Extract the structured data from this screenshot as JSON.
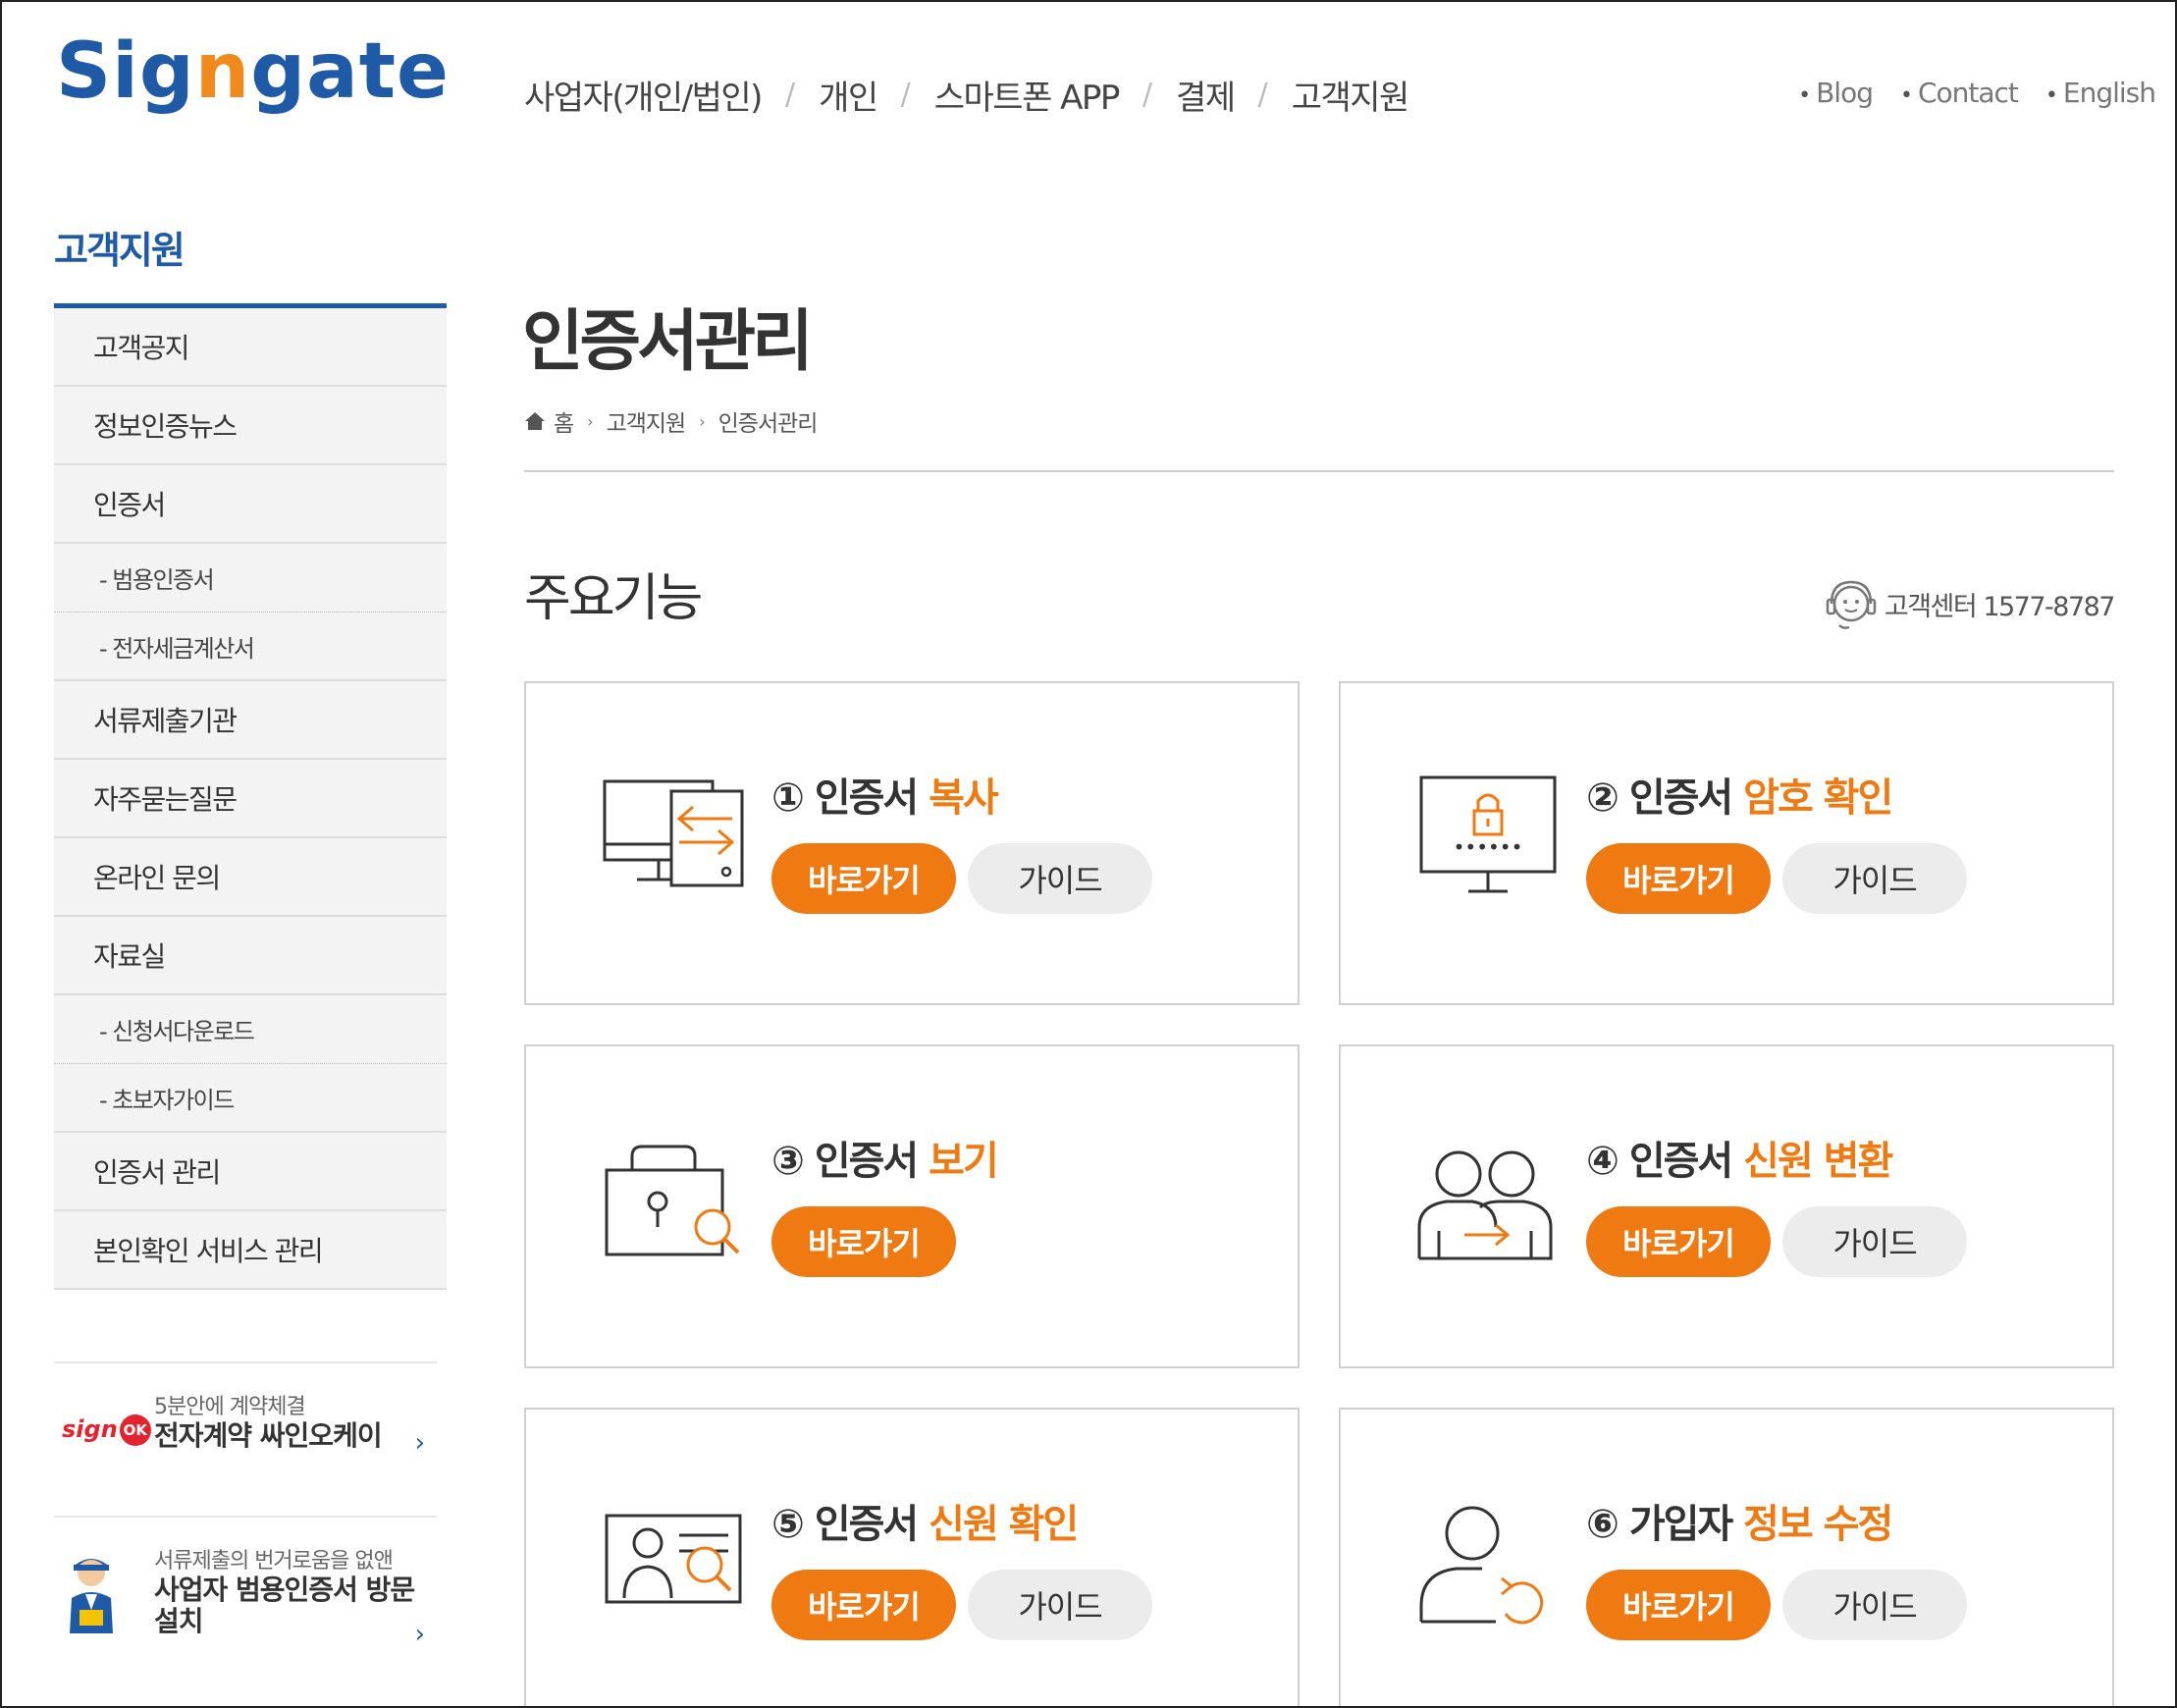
{
  "header": {
    "logo_pre": "Sig",
    "logo_n": "n",
    "logo_post": "gate",
    "nav": [
      "사업자(개인/법인)",
      "개인",
      "스마트폰 APP",
      "결제",
      "고객지원"
    ],
    "util": [
      "Blog",
      "Contact",
      "English"
    ]
  },
  "sidebar": {
    "title": "고객지원",
    "items": [
      {
        "label": "고객공지",
        "sub": false
      },
      {
        "label": "정보인증뉴스",
        "sub": false
      },
      {
        "label": "인증서",
        "sub": false
      },
      {
        "label": "- 범용인증서",
        "sub": true
      },
      {
        "label": "- 전자세금계산서",
        "sub": true
      },
      {
        "label": "서류제출기관",
        "sub": false
      },
      {
        "label": "자주묻는질문",
        "sub": false
      },
      {
        "label": "온라인 문의",
        "sub": false
      },
      {
        "label": "자료실",
        "sub": false
      },
      {
        "label": "- 신청서다운로드",
        "sub": true
      },
      {
        "label": "- 초보자가이드",
        "sub": true
      },
      {
        "label": "인증서 관리",
        "sub": false
      },
      {
        "label": "본인확인 서비스 관리",
        "sub": false
      }
    ],
    "banners": [
      {
        "small": "5분안에 계약체결",
        "big": "전자계약 싸인오케이",
        "logo_text": "sign",
        "logo_badge": "OK"
      },
      {
        "small": "서류제출의 번거로움을 없앤",
        "big": "사업자 범용인증서 방문설치"
      }
    ],
    "arrow": "›"
  },
  "main": {
    "title": "인증서관리",
    "breadcrumb": [
      "홈",
      "고객지원",
      "인증서관리"
    ],
    "crumb_sep": "›",
    "section_title": "주요기능",
    "customer_center": "고객센터 1577-8787",
    "go_label": "바로가기",
    "guide_label": "가이드",
    "cards": [
      {
        "num": "①",
        "pre": "인증서",
        "hl": "복사"
      },
      {
        "num": "②",
        "pre": "인증서",
        "hl": "암호 확인"
      },
      {
        "num": "③",
        "pre": "인증서",
        "hl": "보기"
      },
      {
        "num": "④",
        "pre": "인증서",
        "hl": "신원 변환"
      },
      {
        "num": "⑤",
        "pre": "인증서",
        "hl": "신원 확인"
      },
      {
        "num": "⑥",
        "pre": "가입자",
        "hl": "정보 수정"
      }
    ]
  },
  "colors": {
    "brand_blue": "#1f5aa6",
    "accent_orange": "#ef7a12"
  }
}
